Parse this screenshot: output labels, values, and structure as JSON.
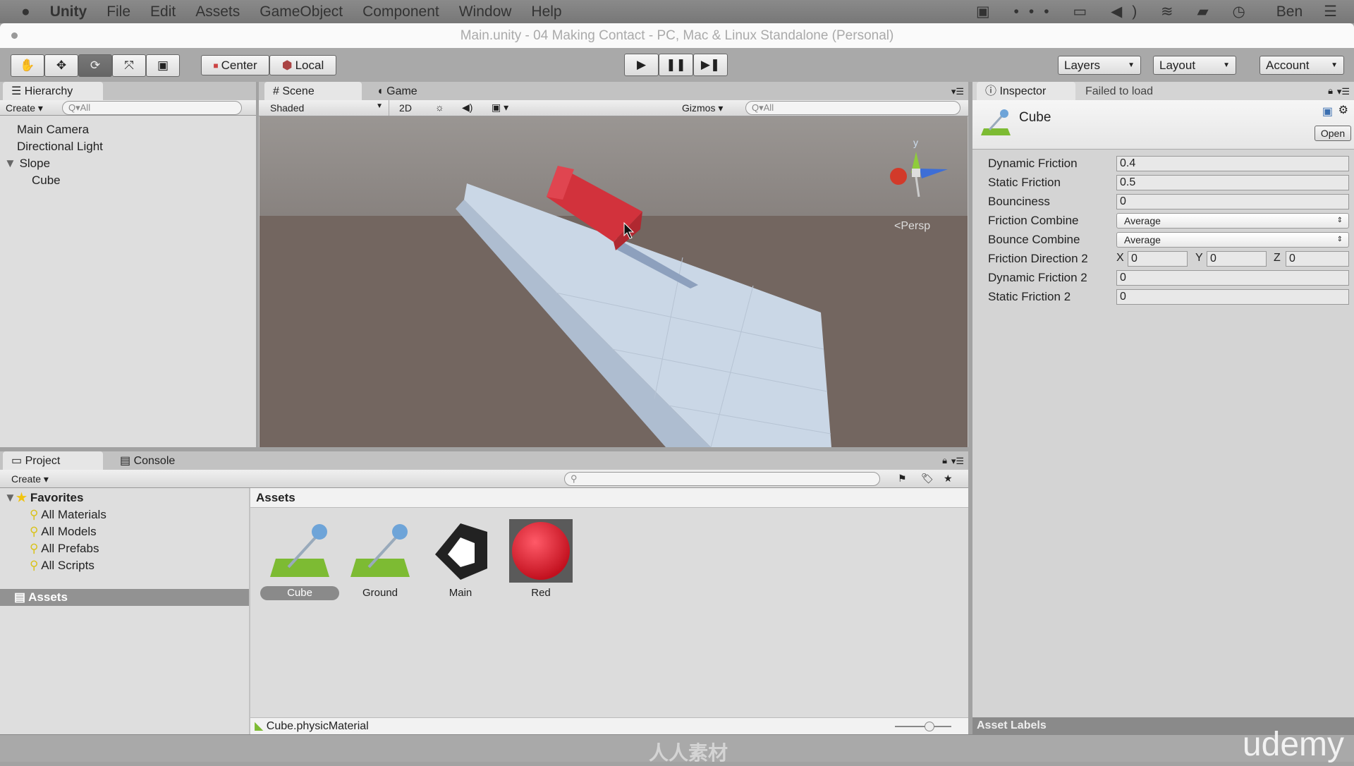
{
  "menubar": {
    "apple": "",
    "app": "Unity",
    "items": [
      "File",
      "Edit",
      "Assets",
      "GameObject",
      "Component",
      "Window",
      "Help"
    ],
    "user": "Ben"
  },
  "window": {
    "title": "Main.unity - 04 Making Contact - PC, Mac & Linux Standalone (Personal)"
  },
  "toolbar": {
    "tools": [
      "hand-tool",
      "move-tool",
      "rotate-tool",
      "scale-tool",
      "rect-tool"
    ],
    "active_tool": "rotate-tool",
    "pivot": "Center",
    "space": "Local",
    "layers": "Layers",
    "layout": "Layout",
    "account": "Account"
  },
  "hierarchy": {
    "tab": "Hierarchy",
    "create": "Create",
    "search_placeholder": "Q▾All",
    "items": [
      {
        "label": "Main Camera",
        "depth": 0
      },
      {
        "label": "Directional Light",
        "depth": 0
      },
      {
        "label": "Slope",
        "depth": 0,
        "expanded": true
      },
      {
        "label": "Cube",
        "depth": 1
      }
    ]
  },
  "scene": {
    "tabs": [
      "Scene",
      "Game"
    ],
    "active_tab": "Scene",
    "shading": "Shaded",
    "mode_2d": "2D",
    "gizmos": "Gizmos",
    "search_placeholder": "Q▾All",
    "projection": "Persp",
    "gizmo_axis_y": "y",
    "colors": {
      "sky": "#8f8a86",
      "ground": "#736660",
      "slope": "#c9d6e6",
      "cube": "#d2323c"
    }
  },
  "inspector": {
    "tabs": [
      "Inspector",
      "Failed to load"
    ],
    "object_name": "Cube",
    "open": "Open",
    "fields": [
      {
        "label": "Dynamic Friction",
        "value": "0.4"
      },
      {
        "label": "Static Friction",
        "value": "0.5"
      },
      {
        "label": "Bounciness",
        "value": "0"
      },
      {
        "label": "Friction Combine",
        "value": "Average",
        "type": "select"
      },
      {
        "label": "Bounce Combine",
        "value": "Average",
        "type": "select"
      },
      {
        "label": "Friction Direction 2",
        "type": "vector3",
        "x": "0",
        "y": "0",
        "z": "0",
        "axes": [
          "X",
          "Y",
          "Z"
        ]
      },
      {
        "label": "Dynamic Friction 2",
        "value": "0"
      },
      {
        "label": "Static Friction 2",
        "value": "0"
      }
    ],
    "asset_labels": "Asset Labels"
  },
  "project": {
    "tabs": [
      "Project",
      "Console"
    ],
    "create": "Create",
    "favorites": "Favorites",
    "favorite_items": [
      "All Materials",
      "All Models",
      "All Prefabs",
      "All Scripts"
    ],
    "root": "Assets",
    "breadcrumb": "Assets",
    "assets": [
      {
        "name": "Cube",
        "type": "physic-material",
        "selected": true
      },
      {
        "name": "Ground",
        "type": "physic-material"
      },
      {
        "name": "Main",
        "type": "unity-scene"
      },
      {
        "name": "Red",
        "type": "material"
      }
    ],
    "selected_path": "Cube.physicMaterial"
  },
  "watermark": {
    "brand": "udemy",
    "text": "人人素材"
  }
}
